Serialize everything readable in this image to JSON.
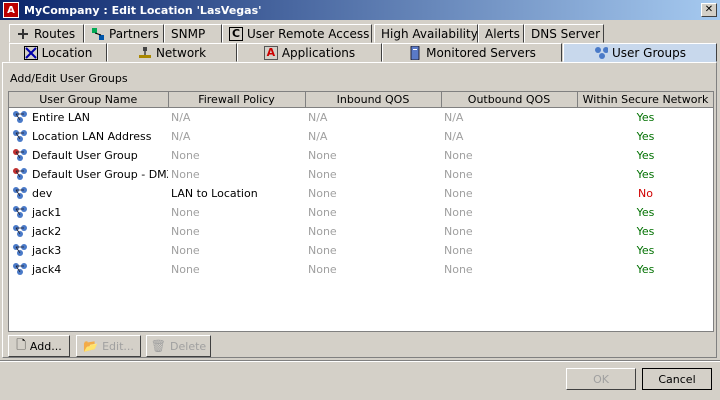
{
  "window": {
    "title": "MyCompany : Edit Location 'LasVegas'",
    "app_icon": "A",
    "close_glyph": "✕"
  },
  "tabs_row1": [
    {
      "label": "Routes",
      "icon": "routes-icon"
    },
    {
      "label": "Partners",
      "icon": "partners-icon"
    },
    {
      "label": "SNMP",
      "icon": ""
    },
    {
      "label": "User Remote Access",
      "icon": "c-icon"
    },
    {
      "label": "High Availability",
      "icon": ""
    },
    {
      "label": "Alerts",
      "icon": ""
    },
    {
      "label": "DNS Server",
      "icon": ""
    }
  ],
  "tabs_row2": [
    {
      "label": "Location",
      "icon": "location-icon"
    },
    {
      "label": "Network",
      "icon": "network-icon"
    },
    {
      "label": "Applications",
      "icon": "applications-icon"
    },
    {
      "label": "Monitored Servers",
      "icon": "server-icon"
    },
    {
      "label": "User Groups",
      "icon": "user-groups-icon",
      "active": true
    }
  ],
  "section_label": "Add/Edit User Groups",
  "table": {
    "columns": [
      "User Group Name",
      "Firewall Policy",
      "Inbound QOS",
      "Outbound QOS",
      "Within Secure Network"
    ],
    "rows": [
      {
        "name": "Entire LAN",
        "firewall": "N/A",
        "inbound": "N/A",
        "outbound": "N/A",
        "secure": "Yes",
        "icon": "blue"
      },
      {
        "name": "Location LAN Address",
        "firewall": "N/A",
        "inbound": "N/A",
        "outbound": "N/A",
        "secure": "Yes",
        "icon": "blue"
      },
      {
        "name": "Default User Group",
        "firewall": "None",
        "inbound": "None",
        "outbound": "None",
        "secure": "Yes",
        "icon": "red"
      },
      {
        "name": "Default User Group - DMZ",
        "firewall": "None",
        "inbound": "None",
        "outbound": "None",
        "secure": "Yes",
        "icon": "red"
      },
      {
        "name": "dev",
        "firewall": "LAN to Location",
        "inbound": "None",
        "outbound": "None",
        "secure": "No",
        "icon": "blue"
      },
      {
        "name": "jack1",
        "firewall": "None",
        "inbound": "None",
        "outbound": "None",
        "secure": "Yes",
        "icon": "blue"
      },
      {
        "name": "jack2",
        "firewall": "None",
        "inbound": "None",
        "outbound": "None",
        "secure": "Yes",
        "icon": "blue"
      },
      {
        "name": "jack3",
        "firewall": "None",
        "inbound": "None",
        "outbound": "None",
        "secure": "Yes",
        "icon": "blue"
      },
      {
        "name": "jack4",
        "firewall": "None",
        "inbound": "None",
        "outbound": "None",
        "secure": "Yes",
        "icon": "blue"
      }
    ]
  },
  "buttons": {
    "add": "Add...",
    "edit": "Edit...",
    "delete": "Delete",
    "ok": "OK",
    "cancel": "Cancel"
  },
  "colors": {
    "yes": "#007000",
    "no": "#d00000",
    "dim": "#a0a0a0",
    "active_tab": "#c8d8ec"
  }
}
